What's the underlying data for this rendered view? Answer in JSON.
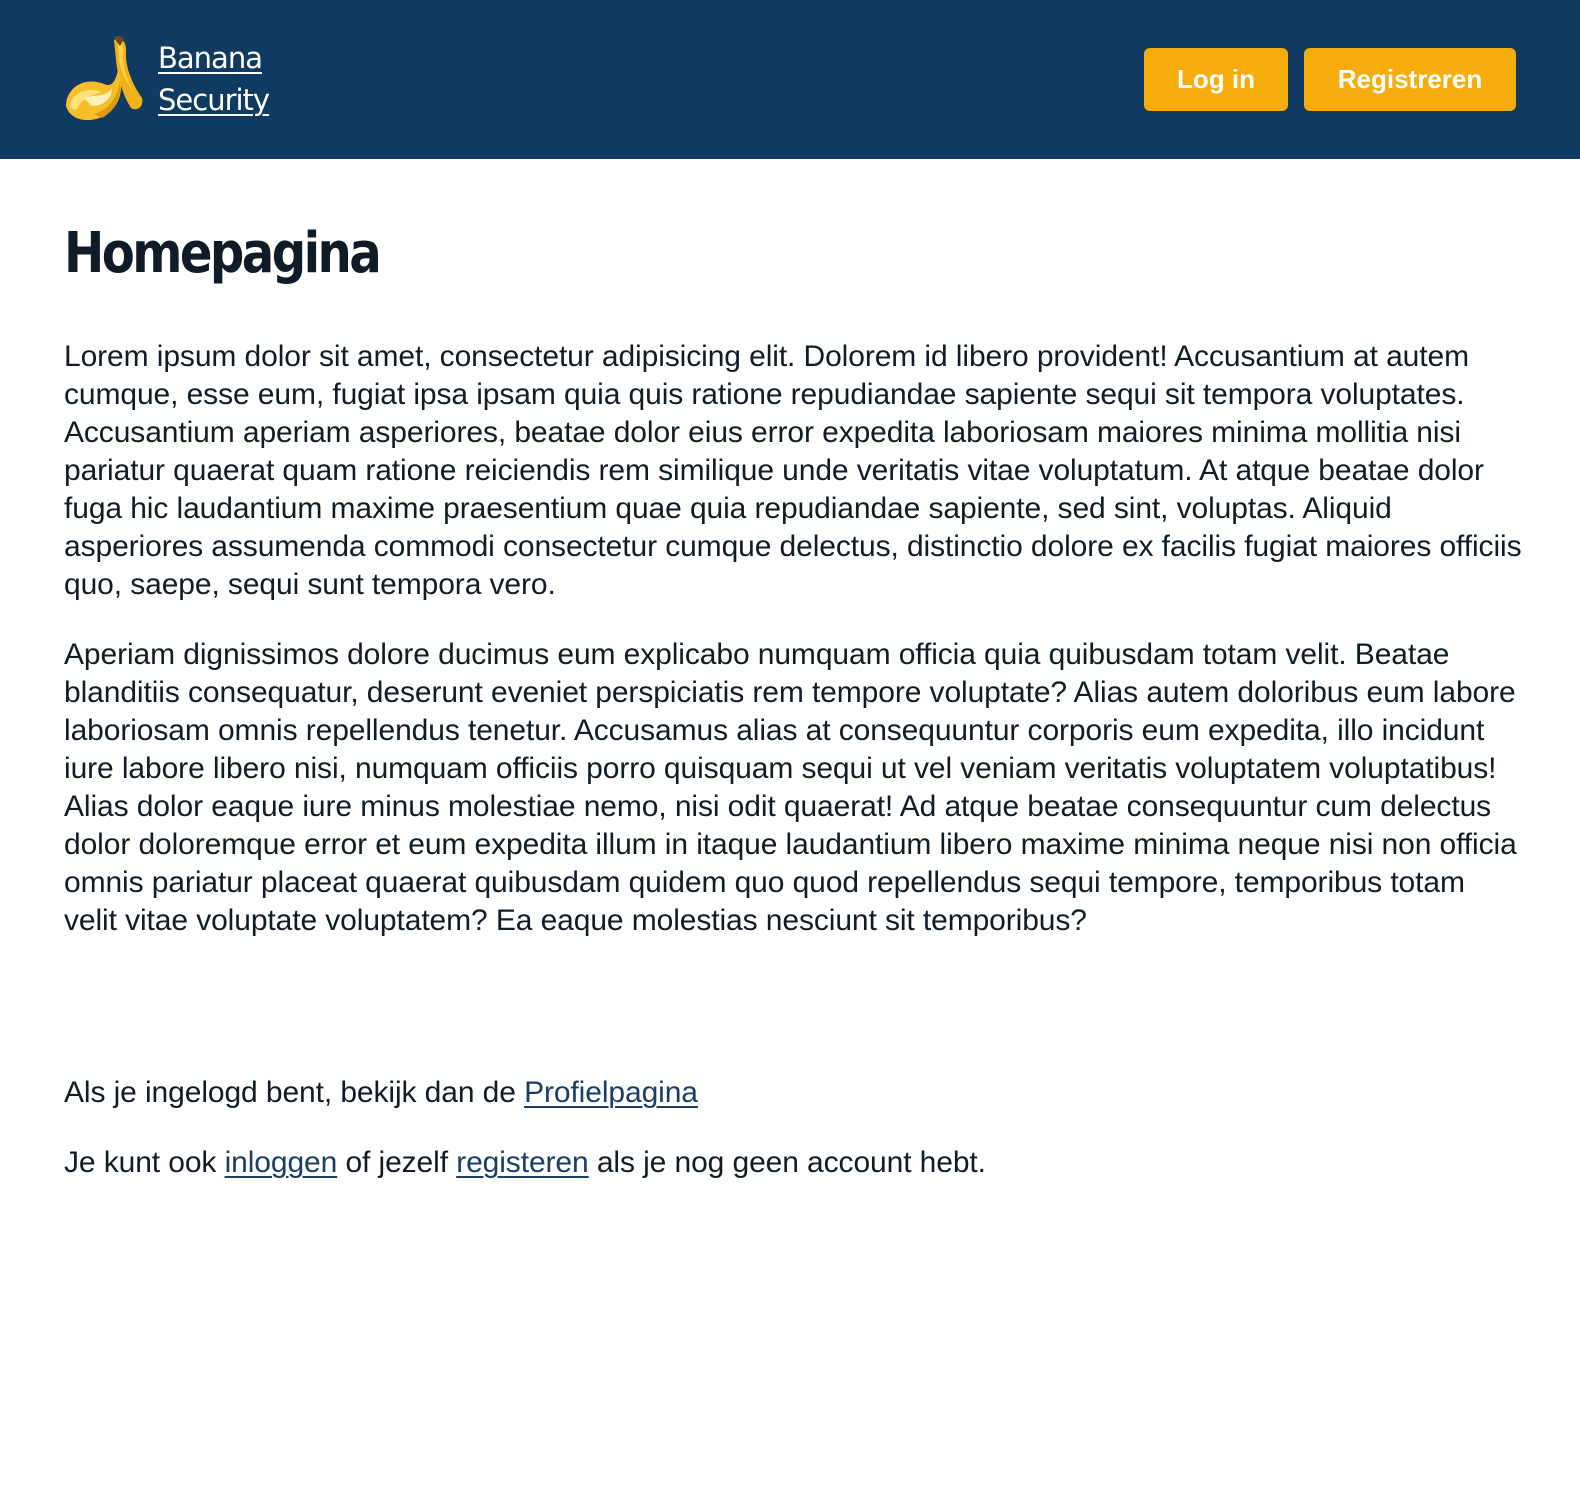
{
  "header": {
    "logo": {
      "line1": "Banana",
      "line2": "Security",
      "icon": "banana-icon"
    },
    "login_label": "Log in",
    "register_label": "Registreren"
  },
  "main": {
    "title": "Homepagina",
    "paragraph1": "Lorem ipsum dolor sit amet, consectetur adipisicing elit. Dolorem id libero provident! Accusantium at autem cumque, esse eum, fugiat ipsa ipsam quia quis ratione repudiandae sapiente sequi sit tempora voluptates. Accusantium aperiam asperiores, beatae dolor eius error expedita laboriosam maiores minima mollitia nisi pariatur quaerat quam ratione reiciendis rem similique unde veritatis vitae voluptatum. At atque beatae dolor fuga hic laudantium maxime praesentium quae quia repudiandae sapiente, sed sint, voluptas. Aliquid asperiores assumenda commodi consectetur cumque delectus, distinctio dolore ex facilis fugiat maiores officiis quo, saepe, sequi sunt tempora vero.",
    "paragraph2": "Aperiam dignissimos dolore ducimus eum explicabo numquam officia quia quibusdam totam velit. Beatae blanditiis consequatur, deserunt eveniet perspiciatis rem tempore voluptate? Alias autem doloribus eum labore laboriosam omnis repellendus tenetur. Accusamus alias at consequuntur corporis eum expedita, illo incidunt iure labore libero nisi, numquam officiis porro quisquam sequi ut vel veniam veritatis voluptatem voluptatibus! Alias dolor eaque iure minus molestiae nemo, nisi odit quaerat! Ad atque beatae consequuntur cum delectus dolor doloremque error et eum expedita illum in itaque laudantium libero maxime minima neque nisi non officia omnis pariatur placeat quaerat quibusdam quidem quo quod repellendus sequi tempore, temporibus totam velit vitae voluptate voluptatem? Ea eaque molestias nesciunt sit temporibus?",
    "profile_line": {
      "prefix": "Als je ingelogd bent, bekijk dan de ",
      "link": "Profielpagina"
    },
    "account_line": {
      "part1": "Je kunt ook ",
      "login_link": "inloggen",
      "part2": " of jezelf ",
      "register_link": "registeren",
      "part3": " als je nog geen account hebt."
    }
  },
  "colors": {
    "header_bg": "#113a63",
    "button_bg": "#f6ad0b",
    "text": "#111c27",
    "link": "#1b3e68"
  }
}
